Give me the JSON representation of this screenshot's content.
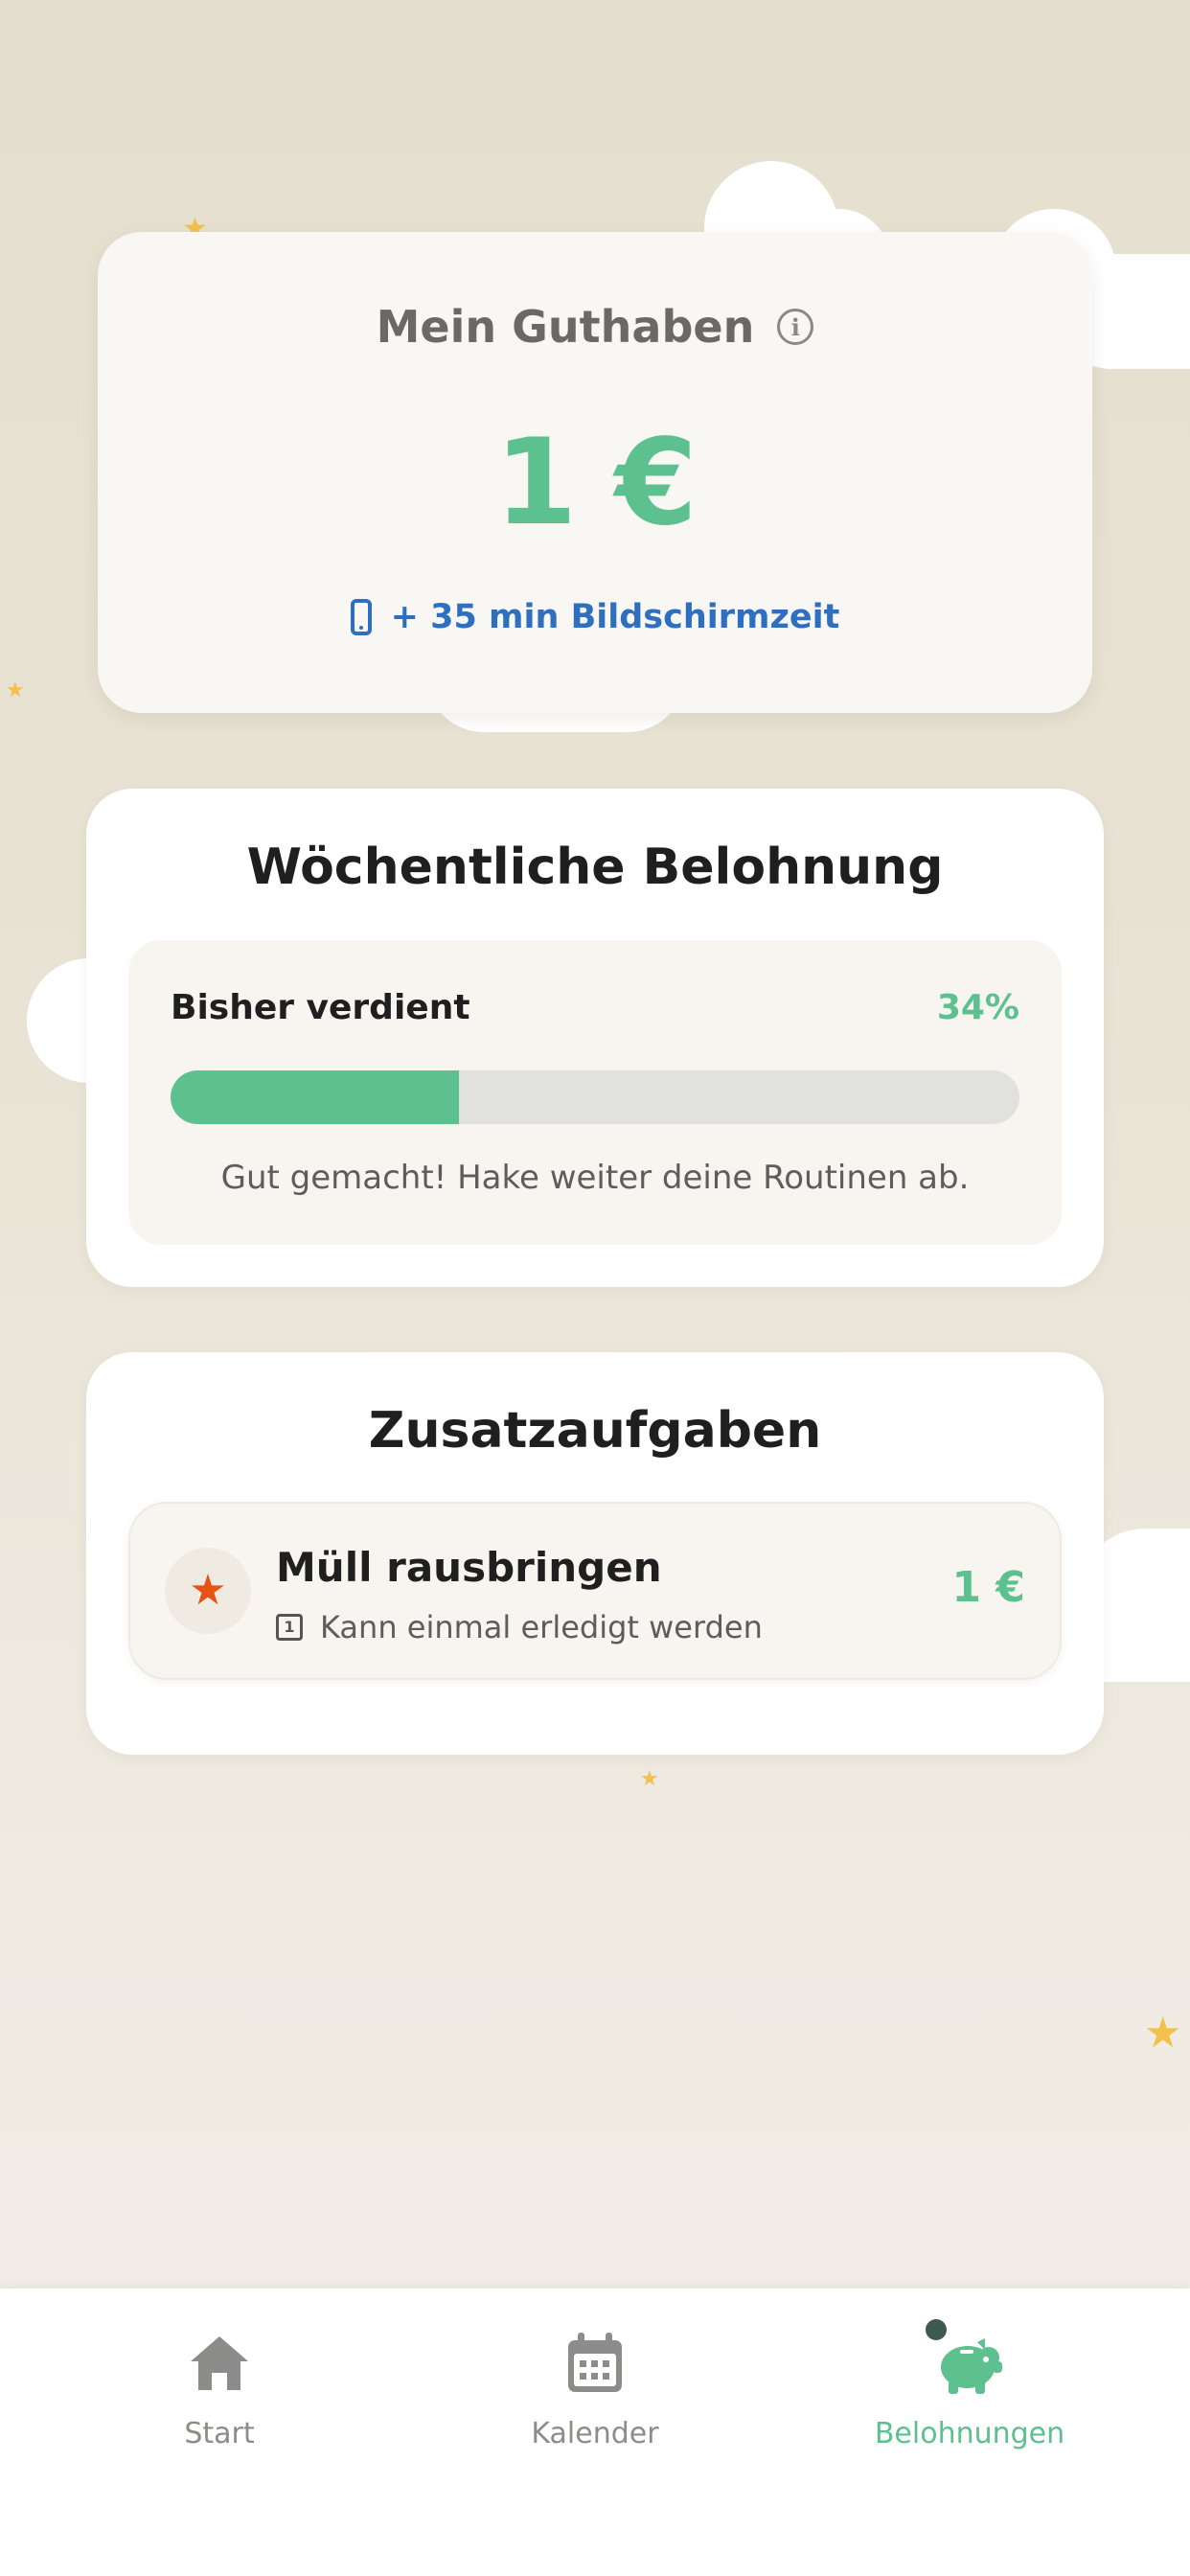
{
  "colors": {
    "accent_green": "#5cc08f",
    "screen_time_blue": "#2f6fbf",
    "star_orange": "#e65314",
    "nav_inactive": "#8c8c8a"
  },
  "balance": {
    "title": "Mein Guthaben",
    "info_icon": "info-icon",
    "amount": "1 €",
    "screen_time_icon": "phone-icon",
    "screen_time": "+ 35 min Bildschirmzeit"
  },
  "weekly_reward": {
    "title": "Wöchentliche Belohnung",
    "earned_label": "Bisher verdient",
    "progress_percent": 34,
    "percent_text": "34%",
    "hint": "Gut gemacht! Hake weiter deine Routinen ab."
  },
  "extra_tasks": {
    "title": "Zusatzaufgaben",
    "items": [
      {
        "icon": "star-icon",
        "title": "Müll rausbringen",
        "frequency_icon": "once-icon",
        "frequency": "Kann einmal erledigt werden",
        "reward": "1 €"
      }
    ]
  },
  "nav": {
    "items": [
      {
        "icon": "home-icon",
        "label": "Start",
        "active": false
      },
      {
        "icon": "calendar-icon",
        "label": "Kalender",
        "active": false
      },
      {
        "icon": "piggy-bank-icon",
        "label": "Belohnungen",
        "active": true,
        "badge": true
      }
    ]
  }
}
